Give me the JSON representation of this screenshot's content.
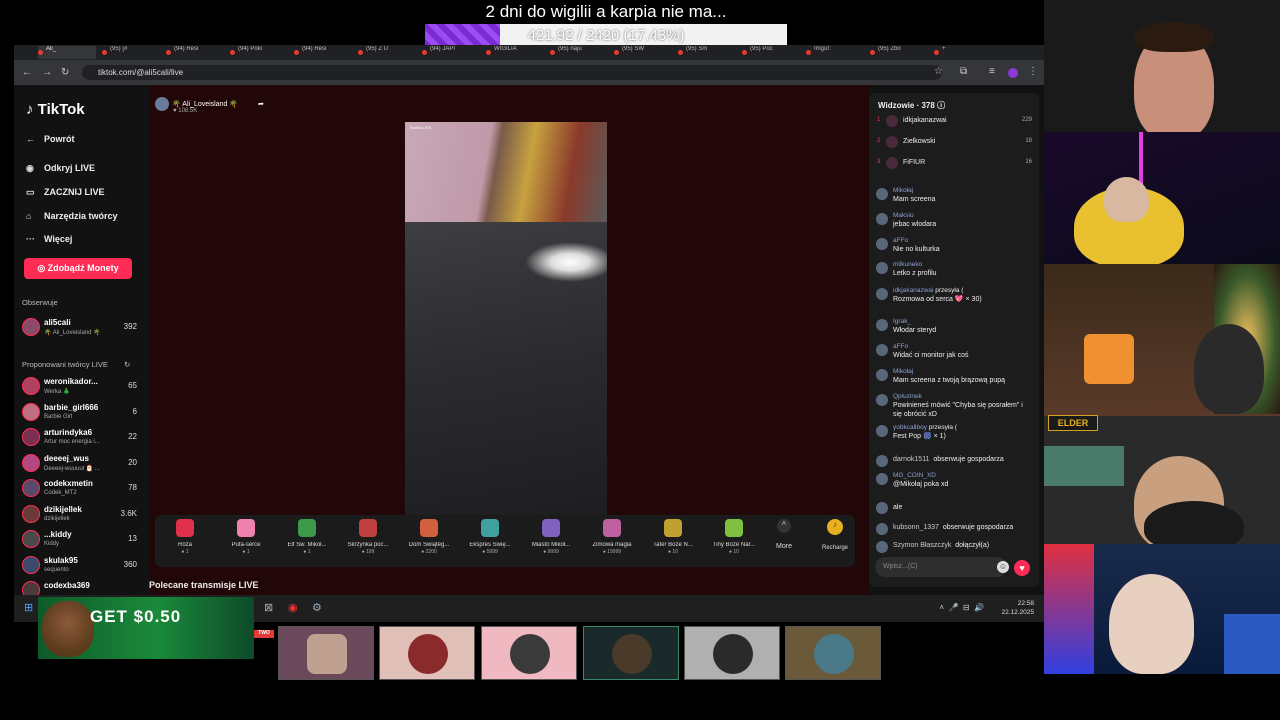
{
  "overlay": {
    "title": "2 dni do wigilii a karpia nie ma...",
    "progress_text": "421.92 / 2420 (17.43%)",
    "progress_fraction": 0.1743
  },
  "browser": {
    "url": "tiktok.com/@ali5cali/live",
    "tabs": [
      {
        "label": "Ali_"
      },
      {
        "label": "(95) [#"
      },
      {
        "label": "(94) Resi"
      },
      {
        "label": "(94) Poki"
      },
      {
        "label": "(94) Resi"
      },
      {
        "label": "(95) Z U"
      },
      {
        "label": "(94) JAPI"
      },
      {
        "label": "WIGILIA"
      },
      {
        "label": "(95) naju"
      },
      {
        "label": "(95) SW"
      },
      {
        "label": "(95) Sm"
      },
      {
        "label": "(95) Poc"
      },
      {
        "label": "Imgur:"
      },
      {
        "label": "(95) Zbo"
      }
    ]
  },
  "sidebar": {
    "logo": "TikTok",
    "nav": [
      {
        "label": "Powrót",
        "icon": "back-arrow-icon"
      },
      {
        "label": "Odkryj LIVE",
        "icon": "live-avatar-icon"
      },
      {
        "label": "ZACZNIJ LIVE",
        "icon": "camera-icon"
      },
      {
        "label": "Narzędzia twórcy",
        "icon": "home-tools-icon"
      },
      {
        "label": "Więcej",
        "icon": "more-dots-icon"
      }
    ],
    "coins_button": "Zdobądź Monety",
    "following_heading": "Obserwuje",
    "following": [
      {
        "name": "ali5cali",
        "sub": "🌴 Ali_Loveisland 🌴",
        "count": "392"
      }
    ],
    "suggested_heading": "Proponowani twórcy LIVE",
    "suggested": [
      {
        "name": "weronikador...",
        "sub": "Werka 🎄",
        "count": "65"
      },
      {
        "name": "barbie_girl666",
        "sub": "Barbie Girl",
        "count": "6"
      },
      {
        "name": "arturindyka6",
        "sub": "Artur moc energia i...",
        "count": "22"
      },
      {
        "name": "deeeej_wus",
        "sub": "Deeeej-wuuuuł 🎅 ...",
        "count": "20"
      },
      {
        "name": "codekxmetin",
        "sub": "Codek_MT2",
        "count": "78"
      },
      {
        "name": "dzikijellek",
        "sub": "dzikijellek",
        "count": "3.6K"
      },
      {
        "name": "...kiddy",
        "sub": "Kiddy",
        "count": "13"
      },
      {
        "name": "skulak95",
        "sub": "sequento",
        "count": "360"
      },
      {
        "name": "codexba369",
        "sub": "",
        "count": ""
      }
    ]
  },
  "stage": {
    "streamer": "🌴 Ali_Loveisland 🌴",
    "likes": "108.5K",
    "video_label": "Twoiva LIVE",
    "video_caption": "🌴 Ali_Loveisland 🌴",
    "gifts": [
      {
        "name": "Róża",
        "price": "1",
        "color": "#e0304a"
      },
      {
        "name": "Pufa-serce",
        "price": "1",
        "color": "#f080b0"
      },
      {
        "name": "Elf Św. Mikoł...",
        "price": "1",
        "color": "#3a9a4a"
      },
      {
        "name": "Skrzynka poc...",
        "price": "199",
        "color": "#c04040"
      },
      {
        "name": "Dom Świąteg...",
        "price": "2200",
        "color": "#d06040"
      },
      {
        "name": "Ekspres Świę...",
        "price": "5999",
        "color": "#40a0a0"
      },
      {
        "name": "Miasto Mikoł...",
        "price": "9999",
        "color": "#8060c0"
      },
      {
        "name": "Zimowa magia",
        "price": "19999",
        "color": "#c060a0"
      },
      {
        "name": "Tater Boże N...",
        "price": "10",
        "color": "#c0a030"
      },
      {
        "name": "Tiny Boże Nar...",
        "price": "10",
        "color": "#80c040"
      }
    ],
    "more_label": "More",
    "recharge_label": "Recharge",
    "recommended_title": "Polecane transmisje LIVE"
  },
  "chat": {
    "viewers_label": "Widzowie · 378",
    "top_viewers": [
      {
        "rank": "1",
        "name": "idkjakanazwai",
        "score": "229"
      },
      {
        "rank": "2",
        "name": "Zielkowski",
        "score": "18"
      },
      {
        "rank": "3",
        "name": "FiFIUR",
        "score": "16"
      }
    ],
    "messages": [
      {
        "user": "Mikołaj",
        "text": "Mam screena"
      },
      {
        "user": "Maksio",
        "text": "jebac wlodara"
      },
      {
        "user": "aFFo",
        "text": "Nie no kulturka"
      },
      {
        "user": "milkuneko",
        "text": "Letko z profilu"
      },
      {
        "user": "idkjakanazwai",
        "text": "Rozmowa od serca 💖 × 30)",
        "inline": "przesyła ("
      },
      {
        "user": "Igrak_",
        "text": "Włodar steryd"
      },
      {
        "user": "aFFo",
        "text": "Widać ci monitor jak coś"
      },
      {
        "user": "Mikołaj",
        "text": "Mam screena z twoją brązową pupą"
      },
      {
        "user": "Qpluzinek",
        "text": "Powinieneś mówić \"Chyba się posrałem\" i się obrócić xD"
      },
      {
        "user": "yobkcallboy",
        "text": "Fest Pop 🎆 × 1)",
        "inline": "przesyła ("
      },
      {
        "user": "darnok1511",
        "text": "",
        "inline": "obserwuje gospodarza"
      },
      {
        "user": "MG_COIN_XD",
        "text": "@Mikołaj poka xd"
      },
      {
        "user": "",
        "text": "ale"
      },
      {
        "user": "kubsonn_1337",
        "text": "",
        "inline": "obserwuje gospodarza"
      },
      {
        "user": "Szymon Błaszczyk",
        "text": "",
        "inline": "dołączył(a)"
      }
    ],
    "input_placeholder": "Wpisz...(C)"
  },
  "taskbar": {
    "time": "22:58",
    "date": "22.12.2025"
  },
  "ad": {
    "text": "GET $0.50"
  },
  "cam_logo": "ELDER"
}
